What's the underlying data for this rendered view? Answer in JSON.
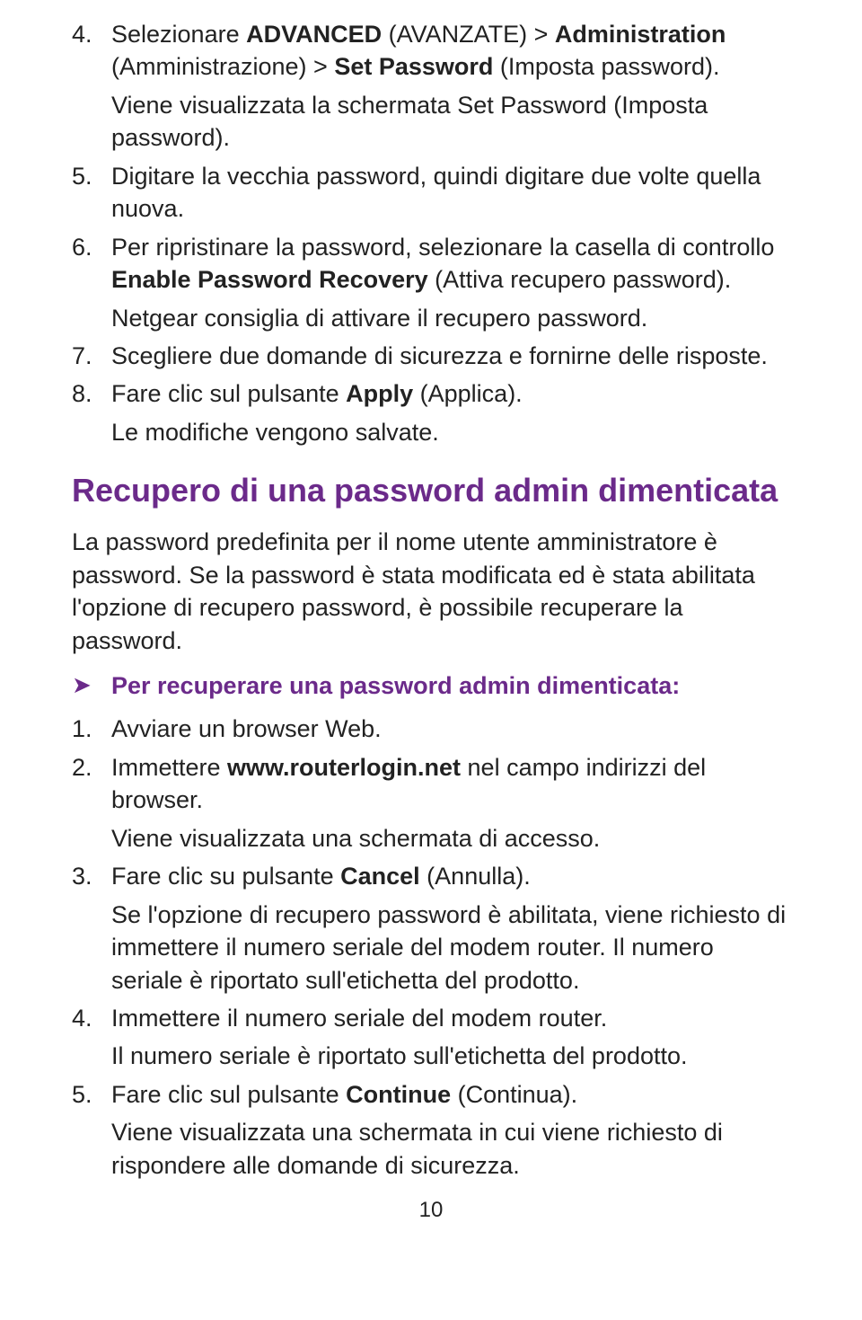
{
  "list1": {
    "i4": {
      "num": "4.",
      "t1a": "Selezionare ",
      "t1b": "ADVANCED",
      "t1c": " (AVANZATE) > ",
      "t1d": "Administration",
      "t1e": " (Amministrazione) > ",
      "t1f": "Set Password",
      "t1g": " (Imposta password).",
      "t2": "Viene visualizzata la schermata Set Password (Imposta password)."
    },
    "i5": {
      "num": "5.",
      "t1": "Digitare la vecchia password, quindi digitare due volte quella nuova."
    },
    "i6": {
      "num": "6.",
      "t1a": "Per ripristinare la password, selezionare la casella di controllo ",
      "t1b": "Enable Password Recovery",
      "t1c": " (Attiva recupero password).",
      "t2": "Netgear consiglia di attivare il recupero password."
    },
    "i7": {
      "num": "7.",
      "t1": "Scegliere due domande di sicurezza e fornirne delle risposte."
    },
    "i8": {
      "num": "8.",
      "t1a": "Fare clic sul pulsante ",
      "t1b": "Apply",
      "t1c": " (Applica).",
      "t2": "Le modifiche vengono salvate."
    }
  },
  "section_heading": "Recupero di una password admin dimenticata",
  "intro_para": "La password predefinita per il nome utente amministratore è password. Se la password è stata modificata ed è stata abilitata l'opzione di recupero password, è possibile recuperare la password.",
  "proc_title": "Per recuperare una password admin dimenticata:",
  "list2": {
    "i1": {
      "num": "1.",
      "t1": "Avviare un browser Web."
    },
    "i2": {
      "num": "2.",
      "t1a": "Immettere ",
      "t1b": "www.routerlogin.net",
      "t1c": " nel campo indirizzi del browser.",
      "t2": "Viene visualizzata una schermata di accesso."
    },
    "i3": {
      "num": "3.",
      "t1a": "Fare clic su pulsante ",
      "t1b": "Cancel",
      "t1c": " (Annulla).",
      "t2": "Se l'opzione di recupero password è abilitata, viene richiesto di immettere il numero seriale del modem router. Il numero seriale è riportato sull'etichetta del prodotto."
    },
    "i4": {
      "num": "4.",
      "t1": "Immettere il numero seriale del modem router.",
      "t2": "Il numero seriale è riportato sull'etichetta del prodotto."
    },
    "i5": {
      "num": "5.",
      "t1a": "Fare clic sul pulsante ",
      "t1b": "Continue",
      "t1c": " (Continua).",
      "t2": "Viene visualizzata una schermata in cui viene richiesto di rispondere alle domande di sicurezza."
    }
  },
  "page_number": "10"
}
